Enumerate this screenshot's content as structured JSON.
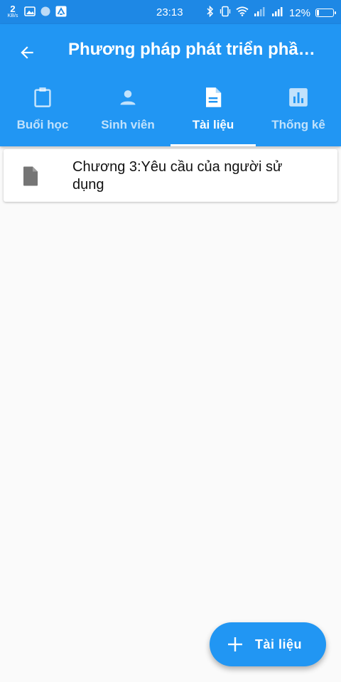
{
  "status_bar": {
    "speed_value": "2",
    "speed_unit": "KB/s",
    "time": "23:13",
    "battery_text": "12%",
    "battery_level": 0.12
  },
  "app_bar": {
    "title": "Phương pháp phát triển phầ…",
    "back_icon": "arrow-back-icon"
  },
  "tabs": [
    {
      "label": "Buổi học",
      "icon": "clipboard-icon",
      "active": false
    },
    {
      "label": "Sinh viên",
      "icon": "person-icon",
      "active": false
    },
    {
      "label": "Tài liệu",
      "icon": "document-icon",
      "active": true
    },
    {
      "label": "Thống kê",
      "icon": "bar-chart-icon",
      "active": false
    }
  ],
  "documents": [
    {
      "title": "Chương 3:Yêu cầu của người sử dụng",
      "icon": "file-icon"
    }
  ],
  "fab": {
    "label": "Tài liệu",
    "icon": "plus-icon"
  },
  "colors": {
    "status_bar": "#1e88e5",
    "primary": "#2196f3",
    "background": "#fafafa",
    "doc_icon": "#757575"
  }
}
